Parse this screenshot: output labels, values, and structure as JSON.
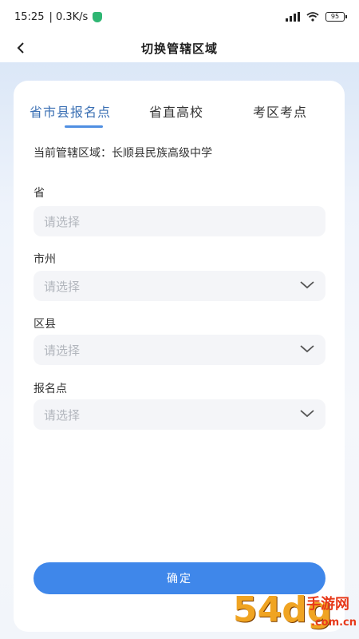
{
  "status_bar": {
    "time": "15:25",
    "network_speed": "| 0.3K/s",
    "battery": "95"
  },
  "nav": {
    "title": "切换管辖区域"
  },
  "tabs": [
    {
      "label": "省市县报名点",
      "active": true
    },
    {
      "label": "省直高校",
      "active": false
    },
    {
      "label": "考区考点",
      "active": false
    }
  ],
  "current_area": "当前管辖区域：长顺县民族高级中学",
  "fields": [
    {
      "label": "省",
      "placeholder": "请选择",
      "has_dropdown": false
    },
    {
      "label": "市州",
      "placeholder": "请选择",
      "has_dropdown": true
    },
    {
      "label": "区县",
      "placeholder": "请选择",
      "has_dropdown": true
    },
    {
      "label": "报名点",
      "placeholder": "请选择",
      "has_dropdown": true
    }
  ],
  "confirm_label": "确定",
  "watermark": {
    "number": "54dg",
    "cn": "手游网",
    "domain": ".com.cn"
  },
  "colors": {
    "accent": "#3f87ea",
    "tab_active": "#3a6fb3",
    "placeholder": "#b2b6bd"
  }
}
